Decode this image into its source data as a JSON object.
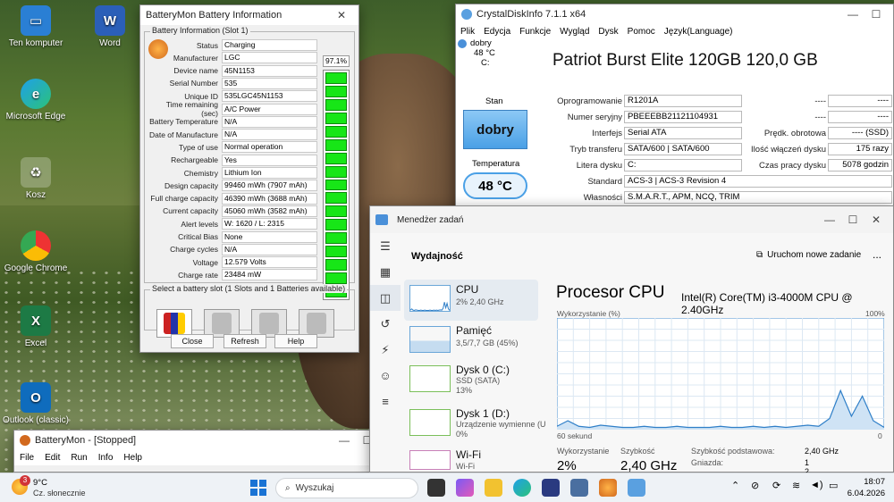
{
  "desktop": {
    "icons": [
      {
        "label": "Ten komputer"
      },
      {
        "label": "Word"
      },
      {
        "label": "Microsoft Edge"
      },
      {
        "label": "Kosz"
      },
      {
        "label": "Google Chrome"
      },
      {
        "label": "Excel"
      },
      {
        "label": "Outlook (classic)"
      }
    ]
  },
  "batterymon_info": {
    "title": "BatteryMon Battery Information",
    "group_title": "Battery Information (Slot 1)",
    "percent": "97.1%",
    "charge_fraction": 0.971,
    "rows": [
      {
        "label": "Status",
        "value": "Charging"
      },
      {
        "label": "Manufacturer",
        "value": "LGC"
      },
      {
        "label": "Device name",
        "value": "45N1153"
      },
      {
        "label": "Serial Number",
        "value": "535"
      },
      {
        "label": "Unique ID",
        "value": "535LGC45N1153"
      },
      {
        "label": "Time remaining (sec)",
        "value": "A/C Power"
      },
      {
        "label": "Battery Temperature",
        "value": "N/A"
      },
      {
        "label": "Date of Manufacture",
        "value": "N/A"
      },
      {
        "label": "Type of use",
        "value": "Normal operation"
      },
      {
        "label": "Rechargeable",
        "value": "Yes"
      },
      {
        "label": "Chemistry",
        "value": "Lithium Ion"
      },
      {
        "label": "Design capacity",
        "value": "99460 mWh (7907 mAh)"
      },
      {
        "label": "Full charge capacity",
        "value": "46390 mWh (3688 mAh)"
      },
      {
        "label": "Current capacity",
        "value": "45060 mWh (3582 mAh)"
      },
      {
        "label": "Alert levels",
        "value": "W: 1620 / L: 2315"
      },
      {
        "label": "Critical Bias",
        "value": "None"
      },
      {
        "label": "Charge cycles",
        "value": "N/A"
      },
      {
        "label": "Voltage",
        "value": "12.579 Volts"
      },
      {
        "label": "Charge rate",
        "value": "23484 mW"
      }
    ],
    "slot_group_title": "Select a battery slot (1 Slots and 1 Batteries available)",
    "close_label": "Close",
    "refresh_label": "Refresh",
    "help_label": "Help"
  },
  "batterymon_main": {
    "title": "BatteryMon - [Stopped]",
    "menu": [
      "File",
      "Edit",
      "Run",
      "Info",
      "Help"
    ]
  },
  "cdi": {
    "title": "CrystalDiskInfo 7.1.1 x64",
    "menu": [
      "Plik",
      "Edycja",
      "Funkcje",
      "Wygląd",
      "Dysk",
      "Pomoc",
      "Język(Language)"
    ],
    "drive_status": "dobry",
    "drive_temp": "48 °C",
    "drive_letter": "C:",
    "model": "Patriot Burst Elite 120GB 120,0 GB",
    "status_label": "Stan",
    "status_value": "dobry",
    "temp_label": "Temperatura",
    "temp_value": "48 °C",
    "fields": {
      "firmware_label": "Oprogramowanie",
      "firmware": "R1201A",
      "serial_label": "Numer seryjny",
      "serial": "PBEEEBB21121104931",
      "interface_label": "Interfejs",
      "interface": "Serial ATA",
      "transfer_label": "Tryb transferu",
      "transfer": "SATA/600 | SATA/600",
      "letter_label": "Litera dysku",
      "letter": "C:",
      "standard_label": "Standard",
      "standard": "ACS-3 | ACS-3 Revision 4",
      "features_label": "Własności",
      "features": "S.M.A.R.T., APM, NCQ, TRIM",
      "r1_label": "----",
      "r1": "----",
      "r2_label": "----",
      "r2": "----",
      "rpm_label": "Prędk. obrotowa",
      "rpm": "---- (SSD)",
      "power_on_count_label": "Ilość włączeń dysku",
      "power_on_count": "175 razy",
      "power_on_hours_label": "Czas pracy dysku",
      "power_on_hours": "5078 godzin"
    }
  },
  "taskmgr": {
    "title": "Menedżer zadań",
    "section": "Wydajność",
    "new_task": "Uruchom nowe zadanie",
    "more": "...",
    "items": [
      {
        "name": "CPU",
        "sub1": "2% 2,40 GHz",
        "sub2": ""
      },
      {
        "name": "Pamięć",
        "sub1": "3,5/7,7 GB (45%)",
        "sub2": ""
      },
      {
        "name": "Dysk 0 (C:)",
        "sub1": "SSD (SATA)",
        "sub2": "13%"
      },
      {
        "name": "Dysk 1 (D:)",
        "sub1": "Urządzenie wymienne (U",
        "sub2": "0%"
      },
      {
        "name": "Wi-Fi",
        "sub1": "Wi-Fi",
        "sub2": ""
      }
    ],
    "cpu_title": "Procesor CPU",
    "cpu_model": "Intel(R) Core(TM) i3-4000M CPU @ 2.40GHz",
    "util_label": "Wykorzystanie (%)",
    "util_max": "100%",
    "util_min": "0",
    "time_label": "60 sekund",
    "util_caption": "Wykorzystanie",
    "util_value": "2%",
    "speed_caption": "Szybkość",
    "speed_value": "2,40 GHz",
    "base_speed_label": "Szybkość podstawowa:",
    "base_speed_value": "2,40 GHz",
    "sockets_label": "Gniazda:",
    "sockets_value": "1",
    "cores_value": "2",
    "chart_data": {
      "type": "area",
      "x": [
        0,
        2,
        4,
        6,
        8,
        10,
        12,
        14,
        16,
        18,
        20,
        22,
        24,
        26,
        28,
        30,
        32,
        34,
        36,
        38,
        40,
        42,
        44,
        46,
        48,
        50,
        52,
        54,
        56,
        58,
        60
      ],
      "values": [
        3,
        8,
        3,
        2,
        4,
        3,
        2,
        2,
        3,
        2,
        2,
        3,
        2,
        2,
        2,
        3,
        2,
        2,
        3,
        2,
        3,
        2,
        3,
        4,
        3,
        10,
        35,
        12,
        30,
        8,
        2
      ],
      "ylim": [
        0,
        100
      ]
    }
  },
  "taskbar": {
    "weather_temp": "9°C",
    "weather_desc": "Cz. słonecznie",
    "weather_badge": "3",
    "search_placeholder": "Wyszukaj",
    "time": "18:07",
    "date": "6.04.2026"
  }
}
